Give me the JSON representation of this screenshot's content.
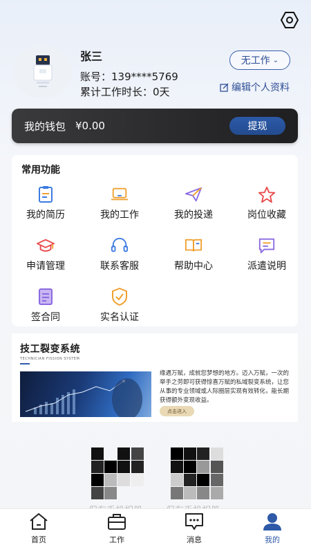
{
  "profile": {
    "name": "张三",
    "account_line": "账号：139****5769",
    "work_time_line": "累计工作时长：0天",
    "status": "无工作",
    "edit_label": "编辑个人资料"
  },
  "wallet": {
    "label": "我的钱包",
    "amount": "¥0.00",
    "withdraw_label": "提现"
  },
  "functions": {
    "title": "常用功能",
    "items": [
      {
        "label": "我的简历",
        "icon": "resume-icon",
        "color": "#3d7be0"
      },
      {
        "label": "我的工作",
        "icon": "laptop-icon",
        "color": "#f0a030"
      },
      {
        "label": "我的投递",
        "icon": "paper-plane-icon",
        "color": "#8b6ae0"
      },
      {
        "label": "岗位收藏",
        "icon": "star-icon",
        "color": "#e84a4a"
      },
      {
        "label": "申请管理",
        "icon": "graduation-cap-icon",
        "color": "#e84a4a"
      },
      {
        "label": "联系客服",
        "icon": "headset-icon",
        "color": "#3d7be0"
      },
      {
        "label": "帮助中心",
        "icon": "book-icon",
        "color": "#f0a030"
      },
      {
        "label": "派遣说明",
        "icon": "message-icon",
        "color": "#8b6ae0"
      },
      {
        "label": "签合同",
        "icon": "document-icon",
        "color": "#8b6ae0"
      },
      {
        "label": "实名认证",
        "icon": "shield-check-icon",
        "color": "#f0a030"
      }
    ]
  },
  "banner": {
    "title": "技工裂变系统",
    "subtitle": "TECHNICIAN FISSION SYSTEM",
    "text": "缘遇万赋，成就您梦想的地方。迈入万赋，一次的举手之劳即可获得惊喜万赋的私域裂变系统，让您从事的专业领域或人际圈层实现有效转化，能长期获得额外变现收益。",
    "button_label": "点击进入"
  },
  "qr_codes": [
    {
      "caption": "保存手机相册"
    },
    {
      "caption": "保存手机相册"
    }
  ],
  "bottom_nav": [
    {
      "label": "首页",
      "icon": "home-icon",
      "active": false
    },
    {
      "label": "工作",
      "icon": "briefcase-icon",
      "active": false
    },
    {
      "label": "消息",
      "icon": "chat-icon",
      "active": false
    },
    {
      "label": "我的",
      "icon": "user-icon",
      "active": true
    }
  ],
  "colors": {
    "accent": "#2e5aa8",
    "wallet_bg": "#2a2a2c"
  }
}
